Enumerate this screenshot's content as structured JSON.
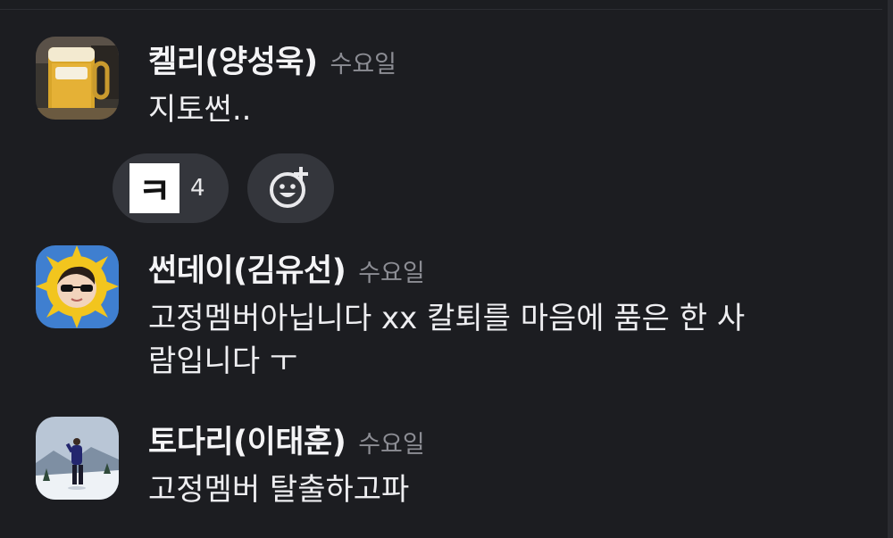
{
  "messages": [
    {
      "name": "켈리(양성욱)",
      "day": "수요일",
      "lines": [
        "지토썬.."
      ],
      "avatar_icon": "beer-glass-avatar",
      "reactions": [
        {
          "emoji": "ㅋ",
          "count": "4"
        }
      ]
    },
    {
      "name": "썬데이(김유선)",
      "day": "수요일",
      "lines": [
        "고정멤버아닙니다 xx 칼퇴를 마음에 품은 한 사",
        "람입니다 ㅜ"
      ],
      "avatar_icon": "sun-face-avatar"
    },
    {
      "name": "토다리(이태훈)",
      "day": "수요일",
      "lines": [
        "고정멤버 탈출하고파"
      ],
      "avatar_icon": "snow-person-avatar"
    }
  ],
  "colors": {
    "background": "#1c1d21",
    "pill": "#34363c",
    "muted_text": "#8c8d94"
  }
}
